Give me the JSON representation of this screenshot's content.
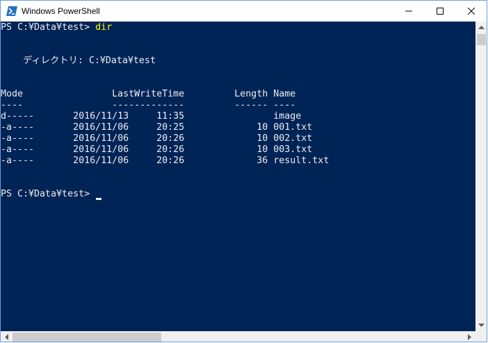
{
  "window": {
    "title": "Windows PowerShell"
  },
  "console": {
    "prompt1": "PS C:¥Data¥test> ",
    "command1": "dir",
    "dir_header": "    ディレクトリ: C:¥Data¥test",
    "col_header": "Mode                LastWriteTime         Length Name",
    "col_underline": "----                -------------         ------ ----",
    "rows": [
      "d-----       2016/11/13     11:35                image",
      "-a----       2016/11/06     20:25             10 001.txt",
      "-a----       2016/11/06     20:26             10 002.txt",
      "-a----       2016/11/06     20:26             10 003.txt",
      "-a----       2016/11/06     20:26             36 result.txt"
    ],
    "prompt2": "PS C:¥Data¥test> "
  },
  "colors": {
    "console_background": "#012456",
    "console_foreground": "#eeedf0",
    "command_color": "#ffff00"
  },
  "icons": {
    "app": "powershell-icon",
    "minimize": "minimize-icon",
    "maximize": "maximize-icon",
    "close": "close-icon"
  }
}
